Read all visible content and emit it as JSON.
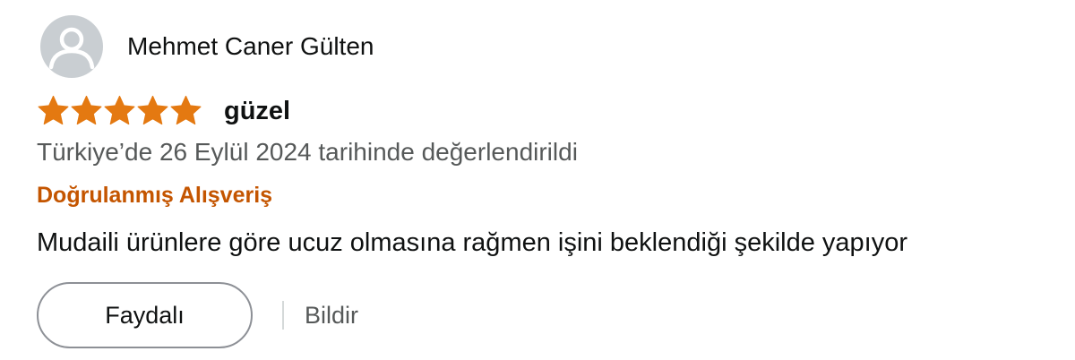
{
  "reviewer": {
    "name": "Mehmet Caner Gülten",
    "avatar_icon": "default-user-icon"
  },
  "review": {
    "rating": 5,
    "rating_max": 5,
    "star_color": "#e47911",
    "title": "güzel",
    "date_text": "Türkiye’de 26 Eylül 2024 tarihinde değerlendirildi",
    "verified_label": "Doğrulanmış Alışveriş",
    "body": "Mudaili ürünlere göre ucuz olmasına rağmen işini beklendiği şekilde yapıyor"
  },
  "actions": {
    "helpful_label": "Faydalı",
    "report_label": "Bildir"
  },
  "colors": {
    "verified": "#c45500",
    "secondary_text": "#565959",
    "avatar_bg": "#c9ced2"
  }
}
